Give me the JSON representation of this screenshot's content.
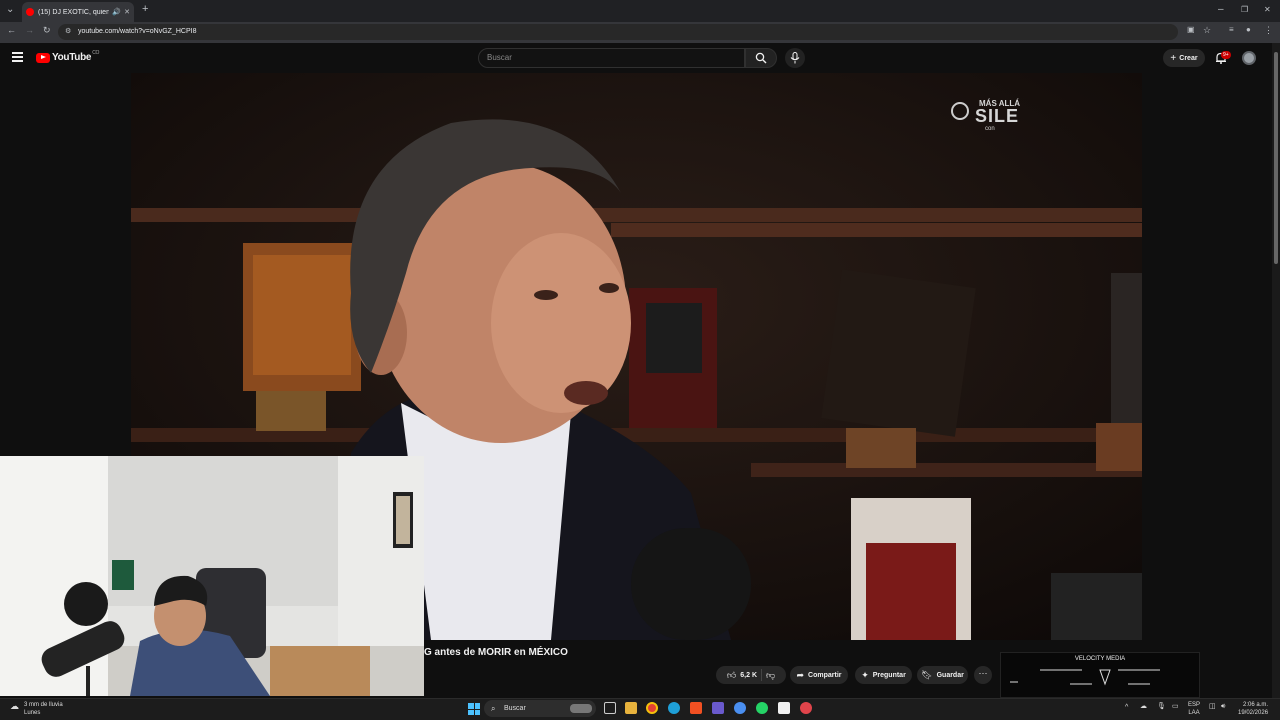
{
  "browser": {
    "tab_title": "(15) DJ EXOTIC, quien está",
    "url": "youtube.com/watch?v=oNvGZ_HCPI8"
  },
  "youtube": {
    "logo_text": "YouTube",
    "country_code": "CO",
    "search_placeholder": "Buscar",
    "create_label": "Crear",
    "notification_badge": "9+"
  },
  "video": {
    "watermark_line1": "MÁS ALLÁ",
    "watermark_line2": "SILE",
    "watermark_line3": "con",
    "title": "G antes de MORIR en MÉXICO"
  },
  "actions": {
    "like_count": "6,2 K",
    "share_label": "Compartir",
    "ask_label": "Preguntar",
    "save_label": "Guardar"
  },
  "overlay": {
    "brand": "VELOCITY MEDIA"
  },
  "taskbar": {
    "weather_line1": "3 mm de lluvia",
    "weather_line2": "Lunes",
    "search_label": "Buscar",
    "lang_line1": "ESP",
    "lang_line2": "LAA",
    "time": "2:06 a.m.",
    "date": "19/02/2026"
  },
  "colors": {
    "youtube_red": "#ff0000",
    "background": "#0f0f0f",
    "pill": "#272727",
    "badge": "#cc0000"
  }
}
